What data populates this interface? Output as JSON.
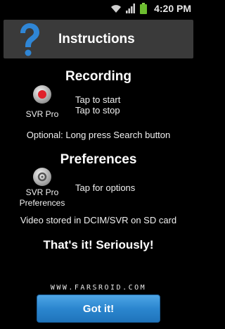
{
  "status_bar": {
    "time": "4:20 PM",
    "icons": [
      "wifi-icon",
      "signal-icon",
      "battery-icon"
    ]
  },
  "header": {
    "title": "Instructions",
    "icon": "question-mark-icon"
  },
  "recording": {
    "heading": "Recording",
    "app_label": "SVR Pro",
    "line1": "Tap to start",
    "line2": "Tap to stop",
    "optional": "Optional: Long press Search button"
  },
  "preferences": {
    "heading": "Preferences",
    "app_label_line1": "SVR Pro",
    "app_label_line2": "Preferences",
    "desc": "Tap for options",
    "storage": "Video stored in DCIM/SVR on SD card"
  },
  "closing": "That's it! Seriously!",
  "watermark": "WWW.FARSROID.COM",
  "button": {
    "label": "Got it!"
  },
  "colors": {
    "button": "#2b86cf",
    "record_red": "#e0202a",
    "title_bar": "#3a3a3a",
    "help_icon": "#2f86d6"
  }
}
